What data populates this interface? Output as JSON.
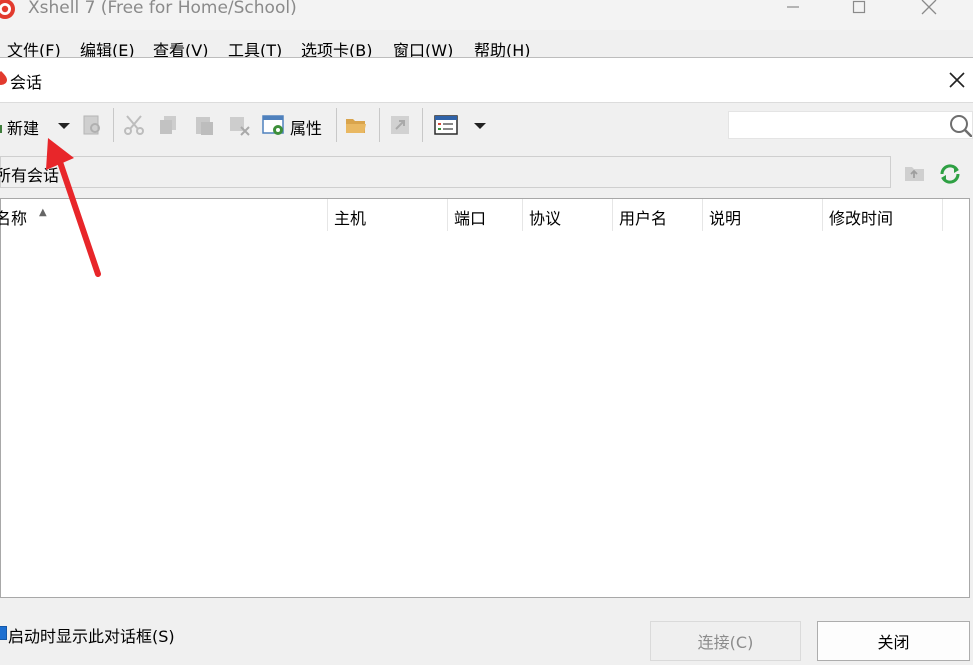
{
  "app": {
    "title": "Xshell 7 (Free for Home/School)"
  },
  "menubar": {
    "items": [
      "文件(F)",
      "编辑(E)",
      "查看(V)",
      "工具(T)",
      "选项卡(B)",
      "窗口(W)",
      "帮助(H)"
    ]
  },
  "dialog": {
    "title": "会话",
    "toolbar": {
      "new_label": "新建",
      "properties_label": "属性",
      "search_placeholder": ""
    },
    "path": "所有会话",
    "columns": [
      "名称",
      "主机",
      "端口",
      "协议",
      "用户名",
      "说明",
      "修改时间"
    ],
    "sort_indicator": "▲",
    "rows": [],
    "startup_checkbox": {
      "label": "启动时显示此对话框(S)",
      "checked": true
    },
    "buttons": {
      "connect": "连接(C)",
      "close": "关闭"
    }
  },
  "colors": {
    "accent": "#1c6fd1",
    "annotation_arrow": "#e8262a",
    "refresh_icon": "#2ea043"
  },
  "icons": {
    "app_logo": "xshell-logo-icon",
    "new": "new-session-icon",
    "properties": "properties-icon",
    "open_folder": "folder-icon",
    "layout": "layout-icon",
    "search": "search-icon",
    "refresh": "refresh-icon"
  }
}
